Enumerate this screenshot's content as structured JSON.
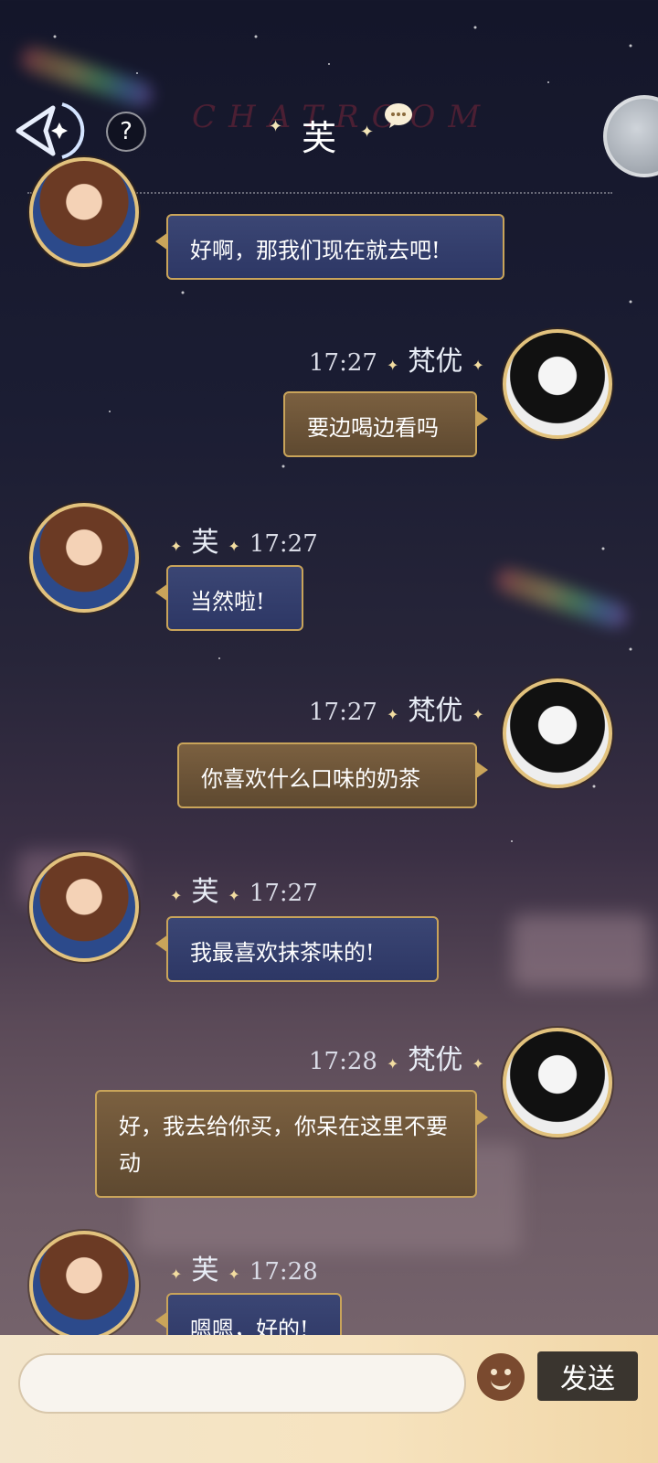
{
  "header": {
    "back_icon": "back-arrow-icon",
    "help_label": "?",
    "background_title": "CHATROOM",
    "title": "芙",
    "chat_icon": "chat-bubble-icon",
    "corner_icon": "planet-icon"
  },
  "messages": [
    {
      "sender": "芙",
      "time": "",
      "text": "好啊，那我们现在就去吧!"
    },
    {
      "sender": "梵优",
      "time": "17:27",
      "text": "要边喝边看吗"
    },
    {
      "sender": "芙",
      "time": "17:27",
      "text": "当然啦!"
    },
    {
      "sender": "梵优",
      "time": "17:27",
      "text": "你喜欢什么口味的奶茶"
    },
    {
      "sender": "芙",
      "time": "17:27",
      "text": "我最喜欢抹茶味的!"
    },
    {
      "sender": "梵优",
      "time": "17:28",
      "text": "好，我去给你买，你呆在这里不要动"
    },
    {
      "sender": "芙",
      "time": "17:28",
      "text": "嗯嗯，好的!"
    }
  ],
  "composer": {
    "placeholder": "",
    "emoji_icon": "smile-face-icon",
    "send_label": "发送"
  },
  "colors": {
    "bubble_blue": "#2d3765",
    "bubble_gold": "#5e4930",
    "border_gold": "#c9a45a",
    "send_button": "#3a352f"
  }
}
